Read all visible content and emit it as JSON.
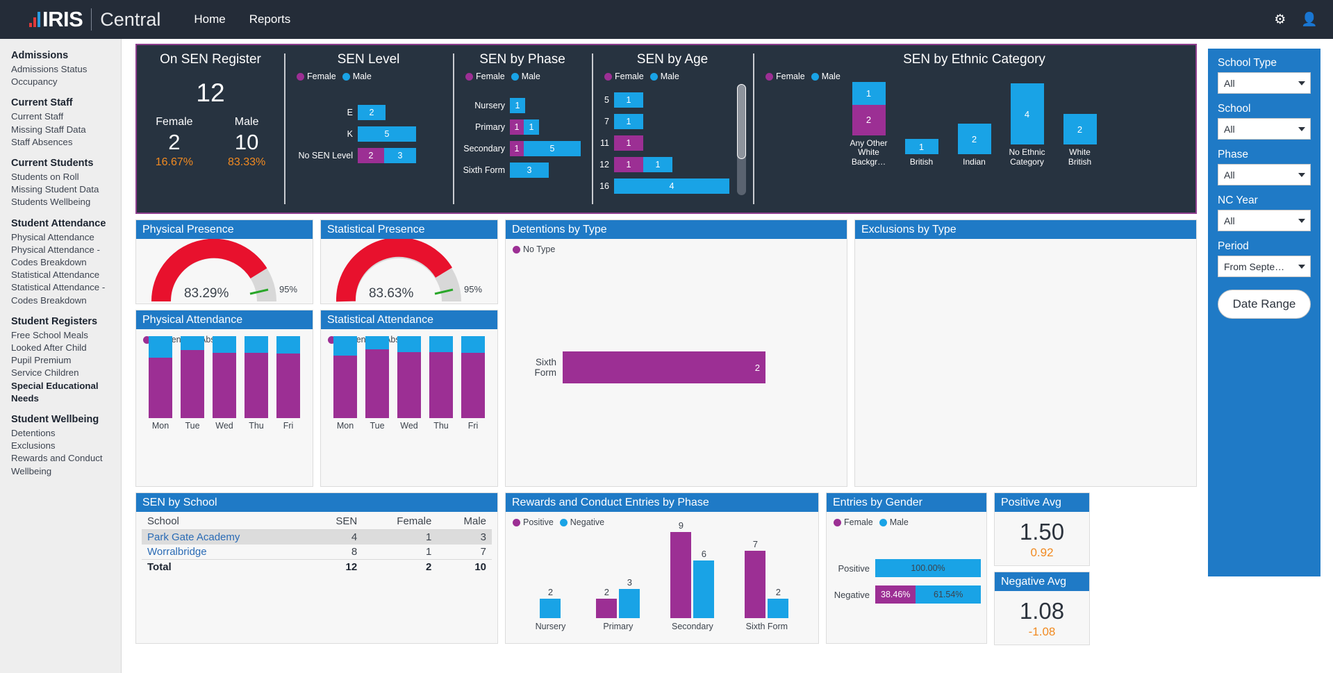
{
  "header": {
    "logo_iris": "IRIS",
    "logo_central": "Central",
    "nav": [
      {
        "label": "Home"
      },
      {
        "label": "Reports"
      }
    ],
    "icons": [
      {
        "name": "gear-icon",
        "glyph": "⚙"
      },
      {
        "name": "user-icon",
        "glyph": "👤"
      }
    ]
  },
  "sidebar": {
    "groups": [
      {
        "heading": "Admissions",
        "items": [
          {
            "label": "Admissions Status",
            "active": false
          },
          {
            "label": "Occupancy",
            "active": false
          }
        ]
      },
      {
        "heading": "Current Staff",
        "items": [
          {
            "label": "Current Staff",
            "active": false
          },
          {
            "label": "Missing Staff Data",
            "active": false
          },
          {
            "label": "Staff Absences",
            "active": false
          }
        ]
      },
      {
        "heading": "Current Students",
        "items": [
          {
            "label": "Students on Roll",
            "active": false
          },
          {
            "label": "Missing Student Data",
            "active": false
          },
          {
            "label": "Students Wellbeing",
            "active": false
          }
        ]
      },
      {
        "heading": "Student Attendance",
        "items": [
          {
            "label": "Physical Attendance",
            "active": false
          },
          {
            "label": "Physical Attendance - Codes Breakdown",
            "active": false
          },
          {
            "label": "Statistical Attendance",
            "active": false
          },
          {
            "label": "Statistical Attendance - Codes Breakdown",
            "active": false
          }
        ]
      },
      {
        "heading": "Student Registers",
        "items": [
          {
            "label": "Free School Meals",
            "active": false
          },
          {
            "label": "Looked After Child",
            "active": false
          },
          {
            "label": "Pupil Premium",
            "active": false
          },
          {
            "label": "Service Children",
            "active": false
          },
          {
            "label": "Special Educational Needs",
            "active": true
          }
        ]
      },
      {
        "heading": "Student Wellbeing",
        "items": [
          {
            "label": "Detentions",
            "active": false
          },
          {
            "label": "Exclusions",
            "active": false
          },
          {
            "label": "Rewards and Conduct",
            "active": false
          },
          {
            "label": "Wellbeing",
            "active": false
          }
        ]
      }
    ]
  },
  "colors": {
    "female": "#9c2f94",
    "male": "#19a3e6",
    "accent_blue": "#1f7ac6",
    "orange": "#f18a21",
    "gauge_red": "#e8112d",
    "target_green": "#2aa72a"
  },
  "legend": {
    "female": "Female",
    "male": "Male",
    "present": "Present",
    "absent": "Absent",
    "positive": "Positive",
    "negative": "Negative",
    "no_type": "No Type"
  },
  "kpi": {
    "register": {
      "title": "On SEN Register",
      "total": "12",
      "female_label": "Female",
      "female_value": "2",
      "female_pct": "16.67%",
      "male_label": "Male",
      "male_value": "10",
      "male_pct": "83.33%"
    }
  },
  "chart_data": [
    {
      "type": "bar",
      "orientation": "horizontal",
      "title": "SEN Level",
      "categories": [
        "E",
        "K",
        "No SEN Level"
      ],
      "series": [
        {
          "name": "Female",
          "values": [
            0,
            0,
            2
          ],
          "color": "#9c2f94"
        },
        {
          "name": "Male",
          "values": [
            2,
            5,
            3
          ],
          "color": "#19a3e6"
        }
      ],
      "stacked": true,
      "xlabel": "",
      "ylabel": ""
    },
    {
      "type": "bar",
      "orientation": "horizontal",
      "title": "SEN by Phase",
      "categories": [
        "Nursery",
        "Primary",
        "Secondary",
        "Sixth Form"
      ],
      "series": [
        {
          "name": "Female",
          "values": [
            0,
            1,
            1,
            0
          ],
          "color": "#9c2f94"
        },
        {
          "name": "Male",
          "values": [
            1,
            1,
            5,
            3
          ],
          "color": "#19a3e6"
        }
      ],
      "stacked": true
    },
    {
      "type": "bar",
      "orientation": "horizontal",
      "title": "SEN by Age",
      "categories": [
        "5",
        "7",
        "11",
        "12",
        "16"
      ],
      "series": [
        {
          "name": "Female",
          "values": [
            0,
            0,
            1,
            1,
            0
          ],
          "color": "#9c2f94"
        },
        {
          "name": "Male",
          "values": [
            1,
            1,
            0,
            1,
            4
          ],
          "color": "#19a3e6"
        }
      ],
      "stacked": true,
      "scrollable": true
    },
    {
      "type": "bar",
      "orientation": "vertical",
      "title": "SEN by Ethnic Category",
      "categories": [
        "Any Other White Backgr…",
        "British",
        "Indian",
        "No Ethnic Category",
        "White British"
      ],
      "series": [
        {
          "name": "Female",
          "values": [
            2,
            0,
            0,
            0,
            0
          ],
          "color": "#9c2f94"
        },
        {
          "name": "Male",
          "values": [
            1,
            1,
            2,
            4,
            2
          ],
          "color": "#19a3e6"
        }
      ],
      "stacked": true
    },
    {
      "type": "gauge",
      "title": "Physical Presence",
      "value": 83.29,
      "value_label": "83.29%",
      "target": 95,
      "target_label": "95%",
      "range": [
        0,
        100
      ]
    },
    {
      "type": "gauge",
      "title": "Statistical Presence",
      "value": 83.63,
      "value_label": "83.63%",
      "target": 95,
      "target_label": "95%",
      "range": [
        0,
        100
      ]
    },
    {
      "type": "bar",
      "orientation": "vertical",
      "title": "Physical Attendance",
      "categories": [
        "Mon",
        "Tue",
        "Wed",
        "Thu",
        "Fri"
      ],
      "series": [
        {
          "name": "Present",
          "values": [
            74,
            83,
            80,
            80,
            79
          ],
          "color": "#9c2f94"
        },
        {
          "name": "Absent",
          "values": [
            26,
            17,
            20,
            20,
            21
          ],
          "color": "#19a3e6"
        }
      ],
      "stacked": true
    },
    {
      "type": "bar",
      "orientation": "vertical",
      "title": "Statistical Attendance",
      "categories": [
        "Mon",
        "Tue",
        "Wed",
        "Thu",
        "Fri"
      ],
      "series": [
        {
          "name": "Present",
          "values": [
            76,
            84,
            81,
            81,
            80
          ],
          "color": "#9c2f94"
        },
        {
          "name": "Absent",
          "values": [
            24,
            16,
            19,
            19,
            20
          ],
          "color": "#19a3e6"
        }
      ],
      "stacked": true
    },
    {
      "type": "bar",
      "orientation": "horizontal",
      "title": "Detentions by Type",
      "categories": [
        "Sixth Form"
      ],
      "series": [
        {
          "name": "No Type",
          "values": [
            2
          ],
          "color": "#9c2f94"
        }
      ],
      "legend_entries": [
        "No Type"
      ]
    },
    {
      "type": "bar",
      "title": "Exclusions by Type",
      "categories": [],
      "series": [],
      "empty": true
    },
    {
      "type": "table",
      "title": "SEN by School",
      "columns": [
        "School",
        "SEN",
        "Female",
        "Male"
      ],
      "rows": [
        [
          "Park Gate Academy",
          "4",
          "1",
          "3"
        ],
        [
          "Worralbridge",
          "8",
          "1",
          "7"
        ]
      ],
      "total_row": [
        "Total",
        "12",
        "2",
        "10"
      ]
    },
    {
      "type": "bar",
      "orientation": "vertical",
      "title": "Rewards and Conduct Entries by Phase",
      "categories": [
        "Nursery",
        "Primary",
        "Secondary",
        "Sixth Form"
      ],
      "series": [
        {
          "name": "Positive",
          "values": [
            0,
            2,
            9,
            7
          ],
          "color": "#9c2f94"
        },
        {
          "name": "Negative",
          "values": [
            2,
            3,
            6,
            2
          ],
          "color": "#19a3e6"
        }
      ],
      "stacked": false,
      "ylim": [
        0,
        9
      ]
    },
    {
      "type": "bar",
      "orientation": "horizontal",
      "title": "Entries by Gender",
      "categories": [
        "Positive",
        "Negative"
      ],
      "series": [
        {
          "name": "Female",
          "values": [
            0,
            38.46
          ],
          "color": "#9c2f94"
        },
        {
          "name": "Male",
          "values": [
            100.0,
            61.54
          ],
          "color": "#19a3e6"
        }
      ],
      "stacked": true,
      "unit": "%",
      "data_labels": [
        [
          "",
          "100.00%"
        ],
        [
          "38.46%",
          "61.54%"
        ]
      ]
    }
  ],
  "panels": {
    "physical_presence": {
      "title": "Physical Presence",
      "value": "83.29%",
      "target": "95%"
    },
    "statistical_presence": {
      "title": "Statistical Presence",
      "value": "83.63%",
      "target": "95%"
    },
    "physical_attendance": {
      "title": "Physical Attendance"
    },
    "statistical_attendance": {
      "title": "Statistical Attendance"
    },
    "detentions": {
      "title": "Detentions by Type",
      "legend": "No Type",
      "row_label": "Sixth Form",
      "value": "2"
    },
    "exclusions": {
      "title": "Exclusions by Type"
    },
    "sen_by_school": {
      "title": "SEN by School",
      "headers": [
        "School",
        "SEN",
        "Female",
        "Male"
      ],
      "rows": [
        {
          "school": "Park Gate Academy",
          "sen": "4",
          "female": "1",
          "male": "3"
        },
        {
          "school": "Worralbridge",
          "sen": "8",
          "female": "1",
          "male": "7"
        }
      ],
      "total": {
        "school": "Total",
        "sen": "12",
        "female": "2",
        "male": "10"
      }
    },
    "rewards": {
      "title": "Rewards and Conduct Entries by Phase"
    },
    "entries_by_gender": {
      "title": "Entries by Gender",
      "rows": [
        {
          "label": "Positive",
          "female": "",
          "male": "100.00%"
        },
        {
          "label": "Negative",
          "female": "38.46%",
          "male": "61.54%"
        }
      ]
    },
    "positive_avg": {
      "title": "Positive Avg",
      "value": "1.50",
      "sub": "0.92"
    },
    "negative_avg": {
      "title": "Negative Avg",
      "value": "1.08",
      "sub": "-1.08"
    }
  },
  "filters": {
    "fields": [
      {
        "label": "School Type",
        "value": "All"
      },
      {
        "label": "School",
        "value": "All"
      },
      {
        "label": "Phase",
        "value": "All"
      },
      {
        "label": "NC Year",
        "value": "All"
      },
      {
        "label": "Period",
        "value": "From Septe…"
      }
    ],
    "date_button": "Date Range"
  }
}
